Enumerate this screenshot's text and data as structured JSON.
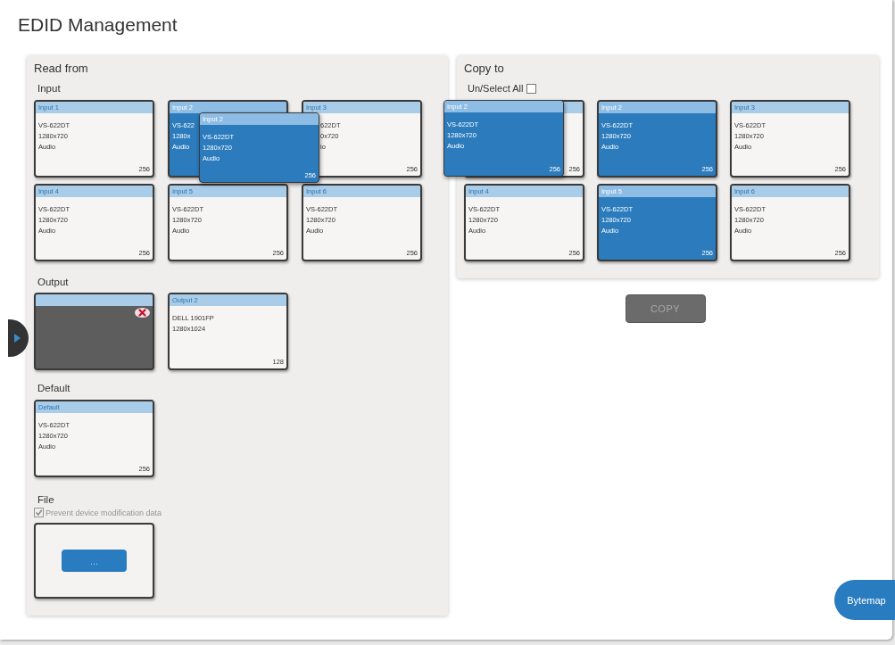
{
  "title": "EDID Management",
  "read_from": {
    "title": "Read from",
    "input": {
      "label": "Input",
      "cards": [
        {
          "title": "Input 1",
          "lines": [
            "VS-622DT",
            "1280x720",
            "Audio"
          ],
          "count": "256",
          "selected": false,
          "left_hidden": false
        },
        {
          "title": "Input 2",
          "lines": [
            "VS-622",
            "1280x",
            "Audio"
          ],
          "selected": true,
          "left_hidden": false
        },
        {
          "title": "Input 3",
          "lines": [
            "622DT",
            "0x720",
            "io"
          ],
          "count": "256",
          "selected": false,
          "left_hidden": true
        },
        {
          "title": "Input 4",
          "lines": [
            "VS-622DT",
            "1280x720",
            "Audio"
          ],
          "count": "256",
          "selected": false,
          "left_hidden": false
        },
        {
          "title": "Input 5",
          "lines": [
            "VS-622DT",
            "1280x720",
            "Audio"
          ],
          "count": "256",
          "selected": false,
          "left_hidden": false
        },
        {
          "title": "Input 6",
          "lines": [
            "VS-622DT",
            "1280x720",
            "Audio"
          ],
          "count": "256",
          "selected": false,
          "left_hidden": false
        }
      ],
      "drag_preview": {
        "title": "Input 2",
        "lines": [
          "VS-622DT",
          "1280x720",
          "Audio"
        ],
        "count": "256",
        "selected": true
      }
    },
    "output": {
      "label": "Output",
      "cards": [
        {
          "connected": false,
          "selected": false
        },
        {
          "title": "Output 2",
          "lines": [
            "DELL 1901FP",
            "1280x1024"
          ],
          "count": "128",
          "connected": true,
          "selected": false
        }
      ]
    },
    "default": {
      "label": "Default",
      "cards": [
        {
          "title": "Default",
          "lines": [
            "VS-622DT",
            "1280x720",
            "Audio"
          ],
          "count": "256",
          "selected": false
        }
      ]
    },
    "file": {
      "label": "File",
      "option": {
        "label": "Prevent device modification data",
        "checked": true,
        "disabled": true
      },
      "button": "..."
    }
  },
  "copy_to": {
    "title": "Copy to",
    "select_all": {
      "label": "Un/Select All",
      "checked": false
    },
    "cards": [
      {
        "count": "256",
        "selected": false
      },
      {
        "title": "Input 2",
        "lines": [
          "VS-622DT",
          "1280x720",
          "Audio"
        ],
        "count": "256",
        "selected": true
      },
      {
        "title": "Input 3",
        "lines": [
          "VS-622DT",
          "1280x720",
          "Audio"
        ],
        "count": "256",
        "selected": false
      },
      {
        "title": "Input 4",
        "lines": [
          "VS-622DT",
          "1280x720",
          "Audio"
        ],
        "count": "256",
        "selected": false
      },
      {
        "title": "Input 5",
        "lines": [
          "VS-622DT",
          "1280x720",
          "Audio"
        ],
        "count": "256",
        "selected": true
      },
      {
        "title": "Input 6",
        "lines": [
          "VS-622DT",
          "1280x720",
          "Audio"
        ],
        "count": "256",
        "selected": false
      }
    ],
    "drag_preview": {
      "title": "Input 2",
      "lines": [
        "VS-622DT",
        "1280x720",
        "Audio"
      ],
      "count": "256",
      "selected": true
    }
  },
  "copy_button": {
    "label": "COPY",
    "disabled": true
  },
  "bytemap_button": {
    "label": "Bytemap"
  }
}
